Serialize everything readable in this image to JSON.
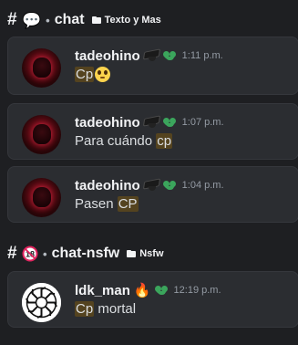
{
  "channels": [
    {
      "hash": "#",
      "badge_icon": "speech-bubble-icon",
      "bullet": "•",
      "name": "chat",
      "category": "Texto y Mas"
    },
    {
      "hash": "#",
      "badge_icon": "no-under-18-icon",
      "badge_text": "18",
      "bullet": "•",
      "name": "chat-nsfw",
      "category": "Nsfw"
    }
  ],
  "messages": [
    {
      "username": "tadeohino",
      "timestamp": "1:11 p.m.",
      "text_parts": [
        "Cp",
        ""
      ],
      "emoji": "pleading-face-icon"
    },
    {
      "username": "tadeohino",
      "timestamp": "1:07 p.m.",
      "text_parts": [
        "Para cuándo ",
        "cp"
      ]
    },
    {
      "username": "tadeohino",
      "timestamp": "1:04 p.m.",
      "text_parts": [
        "Pasen ",
        "CP"
      ]
    },
    {
      "username": "ldk_man",
      "timestamp": "12:19 p.m.",
      "text_parts": [
        "Cp",
        " mortal"
      ]
    }
  ],
  "colors": {
    "background": "#1e1f22",
    "card": "#2b2d31",
    "highlight": "#54431f",
    "leaf_green": "#3ba55c",
    "timestamp": "#949ba4"
  }
}
